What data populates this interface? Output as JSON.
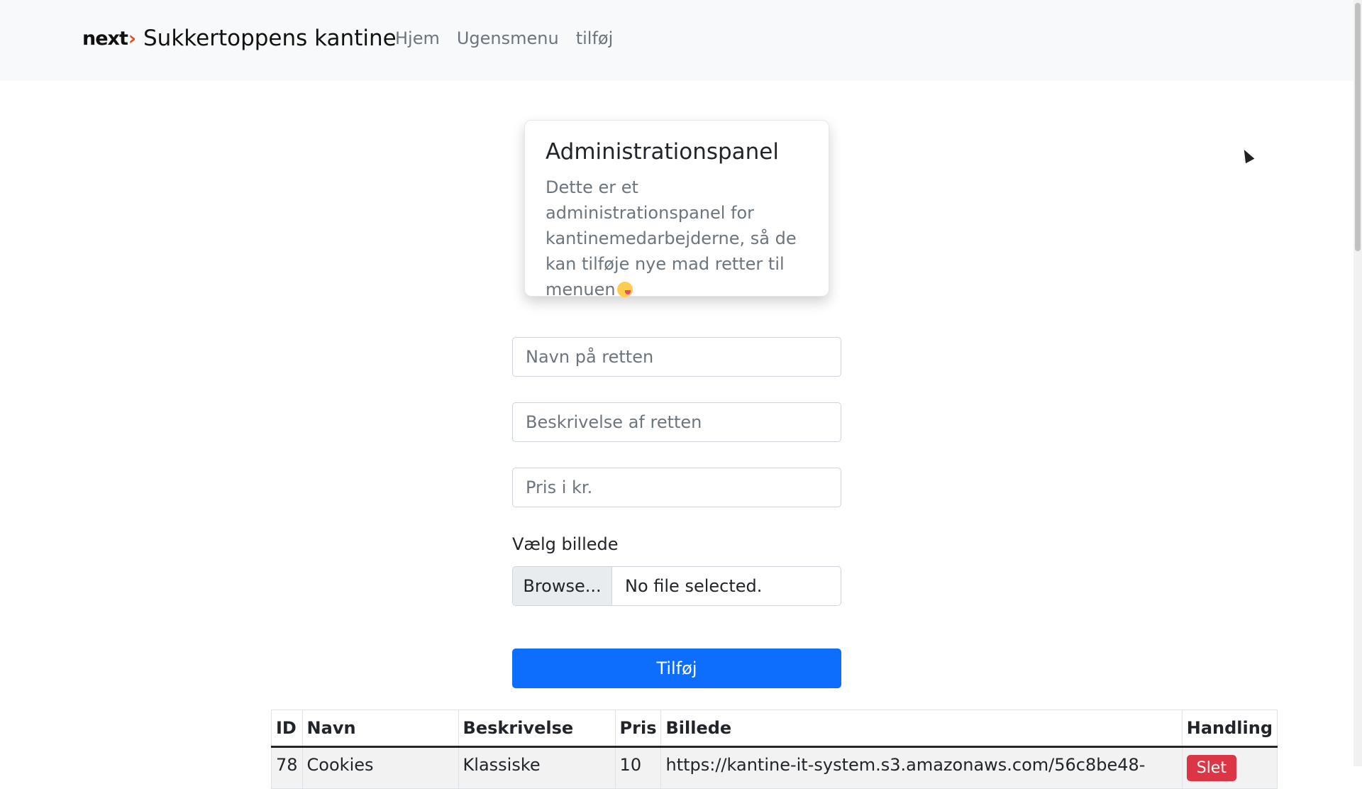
{
  "navbar": {
    "logo_text": "next",
    "logo_arrow": "›",
    "title": "Sukkertoppens kantine",
    "links": [
      "Hjem",
      "Ugensmenu",
      "tilføj"
    ]
  },
  "card": {
    "title": "Administrationspanel",
    "text": "Dette er et administrationspanel for kantinemedarbejderne, så de kan tilføje nye mad retter til menuen"
  },
  "form": {
    "name_placeholder": "Navn på retten",
    "description_placeholder": "Beskrivelse af retten",
    "price_placeholder": "Pris i kr.",
    "image_label": "Vælg billede",
    "browse_label": "Browse...",
    "file_status": "No file selected.",
    "submit_label": "Tilføj"
  },
  "table": {
    "headers": [
      "ID",
      "Navn",
      "Beskrivelse",
      "Pris",
      "Billede",
      "Handling"
    ],
    "rows": [
      {
        "id": "78",
        "name": "Cookies",
        "description": "Klassiske",
        "price": "10",
        "image": "https://kantine-it-system.s3.amazonaws.com/56c8be48-",
        "action": "Slet"
      }
    ]
  },
  "colors": {
    "primary": "#0d6efd",
    "danger": "#dc3545",
    "navbar_bg": "#f8f9fa",
    "logo_accent": "#e34b2b"
  }
}
